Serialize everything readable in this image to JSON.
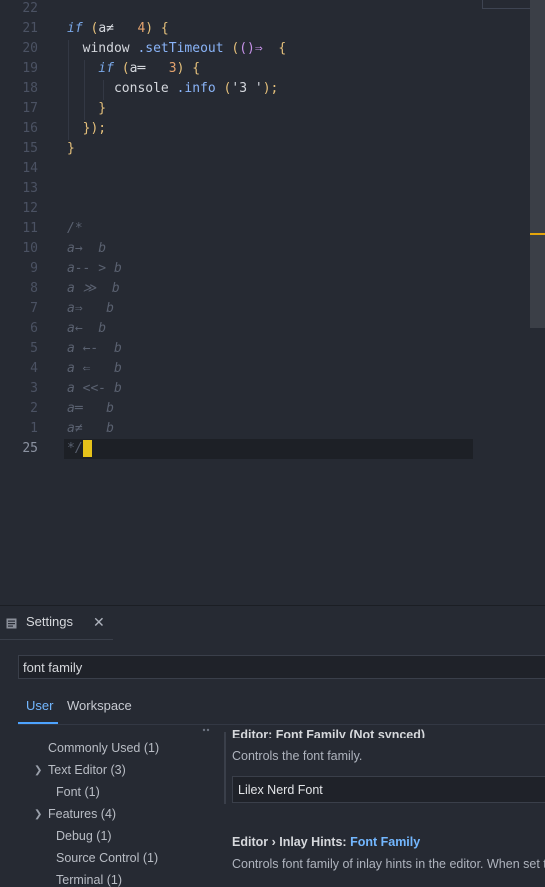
{
  "editor": {
    "lines": [
      {
        "ln": "22"
      },
      {
        "ln": "21",
        "tokens": [
          [
            "kw",
            "if"
          ],
          [
            "punc",
            " ("
          ],
          [
            "ident",
            "a≠"
          ],
          [
            "punc",
            "   "
          ],
          [
            "num",
            "4"
          ],
          [
            "punc",
            ") {"
          ]
        ]
      },
      {
        "ln": "20",
        "tokens": [
          [
            "ident",
            "  window"
          ],
          [
            "method",
            " .setTimeout"
          ],
          [
            "punc",
            " ("
          ],
          [
            "arr",
            "()⇒"
          ],
          [
            "punc",
            "  {"
          ]
        ]
      },
      {
        "ln": "19",
        "tokens": [
          [
            "kw",
            "    if"
          ],
          [
            "punc",
            " ("
          ],
          [
            "ident",
            "a═"
          ],
          [
            "punc",
            "   "
          ],
          [
            "num",
            "3"
          ],
          [
            "punc",
            ") {"
          ]
        ]
      },
      {
        "ln": "18",
        "tokens": [
          [
            "ident",
            "      console"
          ],
          [
            "method",
            " .info"
          ],
          [
            "punc",
            " ("
          ],
          [
            "str",
            "'3 '"
          ],
          [
            "punc",
            ");"
          ]
        ]
      },
      {
        "ln": "17",
        "tokens": [
          [
            "punc",
            "    }"
          ]
        ]
      },
      {
        "ln": "16",
        "tokens": [
          [
            "punc",
            "  });"
          ]
        ]
      },
      {
        "ln": "15",
        "tokens": [
          [
            "punc",
            "}"
          ]
        ]
      },
      {
        "ln": "14"
      },
      {
        "ln": "13"
      },
      {
        "ln": "12"
      },
      {
        "ln": "11",
        "tokens": [
          [
            "cm",
            "/*"
          ]
        ]
      },
      {
        "ln": "10",
        "tokens": [
          [
            "cm",
            "a→  b"
          ]
        ]
      },
      {
        "ln": "9",
        "tokens": [
          [
            "cm",
            "a-- > b"
          ]
        ]
      },
      {
        "ln": "8",
        "tokens": [
          [
            "cm",
            "a ≫  b"
          ]
        ]
      },
      {
        "ln": "7",
        "tokens": [
          [
            "cm",
            "a⇒   b"
          ]
        ]
      },
      {
        "ln": "6",
        "tokens": [
          [
            "cm",
            "a←  b"
          ]
        ]
      },
      {
        "ln": "5",
        "tokens": [
          [
            "cm",
            "a ←-  b"
          ]
        ]
      },
      {
        "ln": "4",
        "tokens": [
          [
            "cm",
            "a ⇐   b"
          ]
        ]
      },
      {
        "ln": "3",
        "tokens": [
          [
            "cm",
            "a <<- b"
          ]
        ]
      },
      {
        "ln": "2",
        "tokens": [
          [
            "cm",
            "a═   b"
          ]
        ]
      },
      {
        "ln": "1",
        "tokens": [
          [
            "cm",
            "a≠   b"
          ]
        ]
      },
      {
        "ln": "25",
        "current": true,
        "tokens": [
          [
            "cm",
            "*/"
          ]
        ]
      }
    ]
  },
  "settings": {
    "tab_title": "Settings",
    "search_value": "font family",
    "scope_tabs": {
      "user": "User",
      "workspace": "Workspace"
    },
    "tree": {
      "commonly_used": "Commonly Used (1)",
      "text_editor": "Text Editor (3)",
      "font": "Font (1)",
      "features": "Features (4)",
      "debug": "Debug (1)",
      "source_control": "Source Control (1)",
      "terminal": "Terminal (1)"
    },
    "setting1": {
      "title": "Editor: Font Family (Not synced)",
      "description": "Controls the font family.",
      "value": "Lilex Nerd Font"
    },
    "setting2": {
      "prefix": "Editor › Inlay Hints: ",
      "name": "Font Family",
      "description": "Controls font family of inlay hints in the editor. When set to"
    }
  },
  "colors": {
    "accent": "#4da3ff",
    "cursor": "#e6c21a",
    "keyword": "#7aa8e8",
    "number": "#e4a36e"
  }
}
